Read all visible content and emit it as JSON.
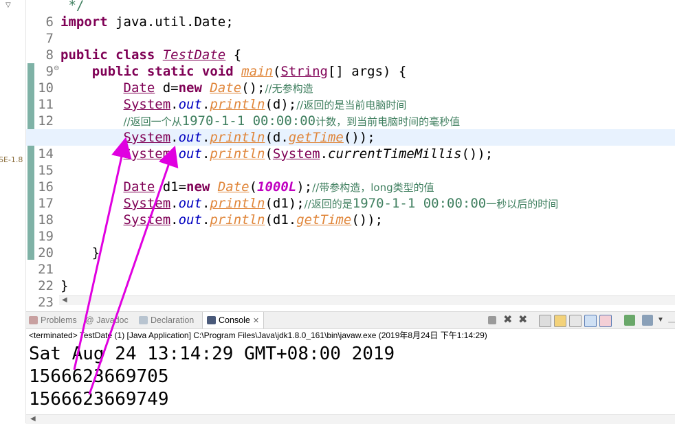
{
  "side": {
    "jre_label": "SE-1.8"
  },
  "editor": {
    "lines": [
      {
        "num": "6",
        "t": " */"
      },
      {
        "num": "7",
        "t": "import java.util.Date;"
      },
      {
        "num": "8",
        "t": ""
      },
      {
        "num": "9",
        "t": "public class TestDate {"
      },
      {
        "num": "10",
        "t": "    public static void main(String[] args) {"
      },
      {
        "num": "11",
        "t": "        Date d=new Date();//无参构造"
      },
      {
        "num": "12",
        "t": "        System.out.println(d);//返回的是当前电脑时间"
      },
      {
        "num": "13",
        "t": "        //返回一个从1970-1-1 00:00:00计数，到当前电脑时间的毫秒值"
      },
      {
        "num": "14",
        "t": "        System.out.println(d.getTime());"
      },
      {
        "num": "15",
        "t": "        System.out.println(System.currentTimeMillis());"
      },
      {
        "num": "16",
        "t": ""
      },
      {
        "num": "17",
        "t": "        Date d1=new Date(1000L);//带参构造，long类型的值"
      },
      {
        "num": "18",
        "t": "        System.out.println(d1);//返回的是1970-1-1 00:00:00一秒以后的时间"
      },
      {
        "num": "19",
        "t": "        System.out.println(d1.getTime());"
      },
      {
        "num": "20",
        "t": ""
      },
      {
        "num": "21",
        "t": "    }"
      },
      {
        "num": "22",
        "t": ""
      },
      {
        "num": "23",
        "t": "}"
      }
    ]
  },
  "tabs": {
    "problems": "Problems",
    "javadoc": "Javadoc",
    "declaration": "Declaration",
    "console": "Console",
    "close": "✕"
  },
  "console": {
    "status": "<terminated> TestDate (1) [Java Application] C:\\Program Files\\Java\\jdk1.8.0_161\\bin\\javaw.exe (2019年8月24日 下午1:14:29)",
    "output": [
      "Sat Aug 24 13:14:29 GMT+08:00 2019",
      "1566623669705",
      "1566623669749"
    ]
  },
  "colors": {
    "keyword": "#7f0055",
    "comment": "#3f7f5f",
    "method": "#e0863a",
    "field": "#0000c0",
    "annotation_arrow": "#e000e0"
  }
}
